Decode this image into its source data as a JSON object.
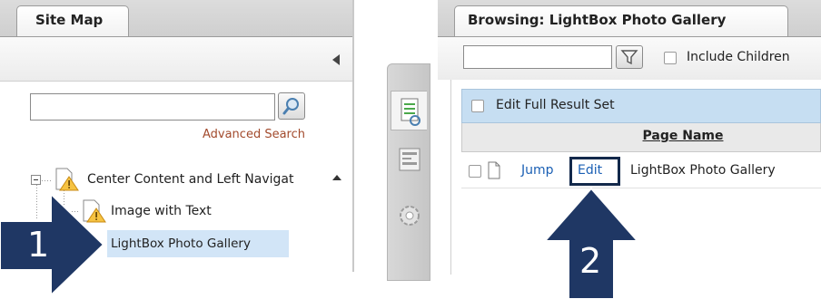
{
  "site_map": {
    "tab_label": "Site Map",
    "search": {
      "value": "",
      "placeholder": ""
    },
    "advanced_search_label": "Advanced Search",
    "tree": [
      {
        "label": "Center Content and Left Navigat",
        "icon": "warning-page-icon",
        "expanded": true
      },
      {
        "label": "Image with Text",
        "icon": "warning-page-icon"
      },
      {
        "label": "LightBox Photo Gallery",
        "icon": "page-icon",
        "selected": true
      }
    ]
  },
  "middle_toolbar": {
    "icons": [
      "page-list-icon",
      "form-icon",
      "gear-icon"
    ]
  },
  "browsing": {
    "tab_label": "Browsing: LightBox Photo Gallery",
    "filter": {
      "value": "",
      "placeholder": ""
    },
    "include_children_label": "Include Children",
    "edit_full_result_set_label": "Edit Full Result Set",
    "column_header": "Page Name",
    "rows": [
      {
        "jump_label": "Jump",
        "edit_label": "Edit",
        "page_name": "LightBox Photo Gallery"
      }
    ]
  },
  "annotations": {
    "step1": "1",
    "step2": "2",
    "arrow_color": "#1f3764",
    "highlight_color": "#13294b"
  }
}
